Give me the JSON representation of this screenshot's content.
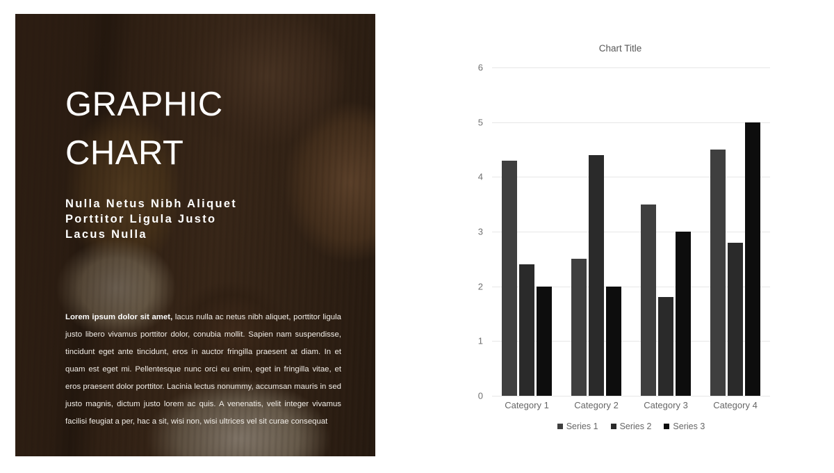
{
  "slide": {
    "headline": "GRAPHIC\nCHART",
    "subheadline": "Nulla Netus Nibh Aliquet\nPorttitor Ligula Justo\nLacus Nulla",
    "body_lead": "Lorem ipsum dolor sit amet,",
    "body_text": " lacus nulla ac netus nibh aliquet, porttitor ligula justo libero vivamus porttitor dolor, conubia mollit. Sapien nam suspendisse, tincidunt eget ante tincidunt, eros in auctor fringilla praesent at diam. In et quam est eget mi. Pellentesque nunc orci eu enim, eget in fringilla vitae, et eros praesent dolor porttitor. Lacinia lectus nonummy, accumsan mauris in sed justo magnis, dictum justo lorem ac quis. A venenatis, velit integer vivamus facilisi feugiat a per, hac a sit, wisi non, wisi ultrices vel sit curae consequat",
    "image_alt": "chocolate-ice-cream-photo"
  },
  "chart_data": {
    "type": "bar",
    "title": "Chart Title",
    "xlabel": "",
    "ylabel": "",
    "categories": [
      "Category 1",
      "Category 2",
      "Category 3",
      "Category 4"
    ],
    "series": [
      {
        "name": "Series 1",
        "color": "#3f3f3f",
        "values": [
          4.3,
          2.5,
          3.5,
          4.5
        ]
      },
      {
        "name": "Series 2",
        "color": "#2a2a2a",
        "values": [
          2.4,
          4.4,
          1.8,
          2.8
        ]
      },
      {
        "name": "Series 3",
        "color": "#0d0d0d",
        "values": [
          2.0,
          2.0,
          3.0,
          5.0
        ]
      }
    ],
    "ylim": [
      0,
      6
    ],
    "yticks": [
      0,
      1,
      2,
      3,
      4,
      5,
      6
    ],
    "grid": true,
    "legend_position": "bottom"
  }
}
